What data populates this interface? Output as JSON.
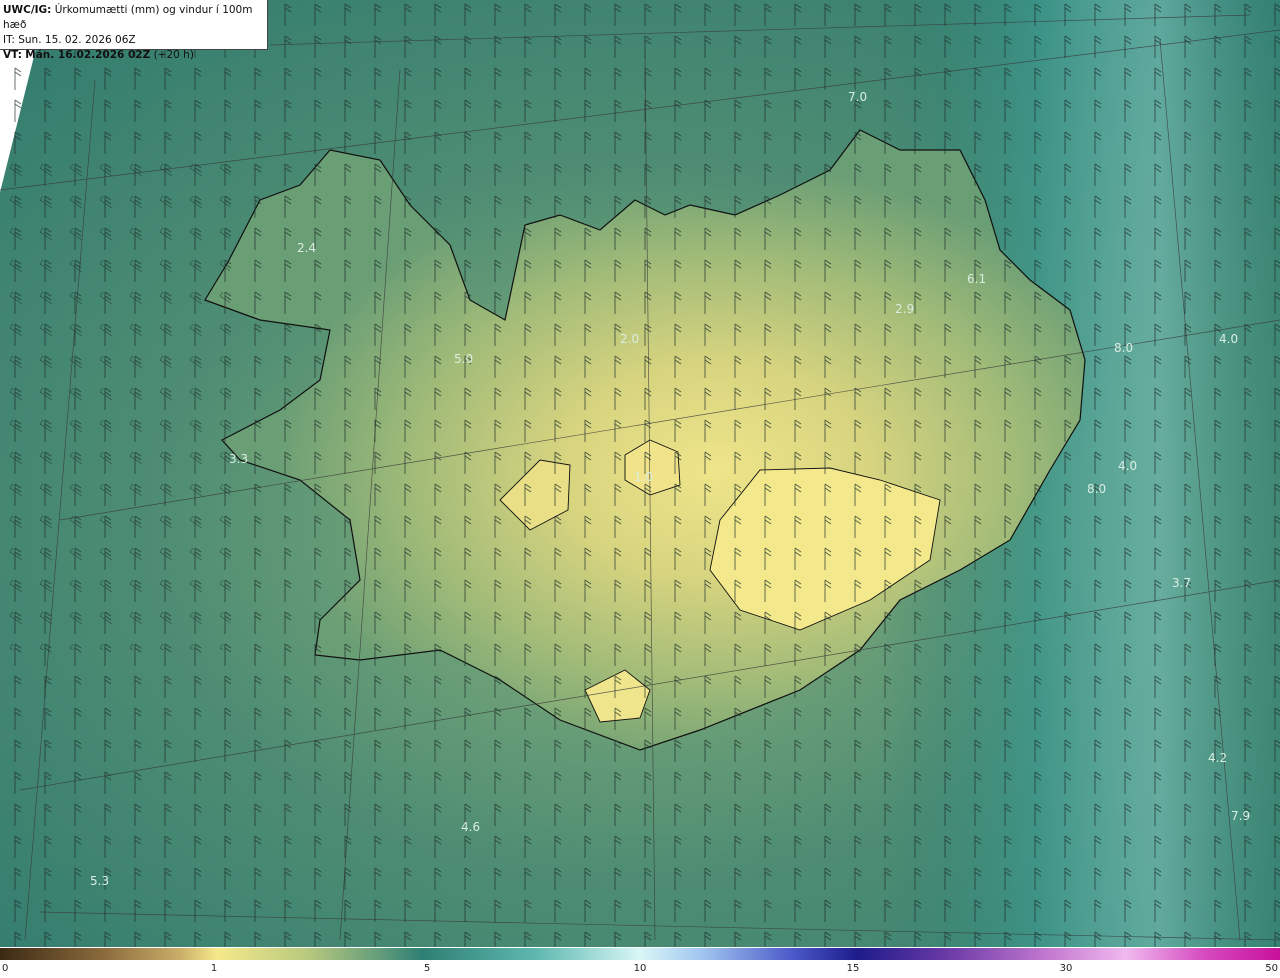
{
  "header": {
    "model": "UWC/IG:",
    "title": "Úrkomumætti (mm) og vindur í 100m hæð",
    "issued": "IT: Sun. 15. 02. 2026 06Z",
    "valid_prefix": "VT:",
    "valid": "Mán. 16.02.2026 02Z",
    "lead": "(+20 h)"
  },
  "map_values": [
    {
      "id": "v1",
      "label": "7.0"
    },
    {
      "id": "v2",
      "label": "2.4"
    },
    {
      "id": "v3",
      "label": "5.0"
    },
    {
      "id": "v4",
      "label": "2.0"
    },
    {
      "id": "v5",
      "label": "2.9"
    },
    {
      "id": "v6",
      "label": "6.1"
    },
    {
      "id": "v7",
      "label": "8.0"
    },
    {
      "id": "v8",
      "label": "4.0"
    },
    {
      "id": "v9",
      "label": "3.3"
    },
    {
      "id": "v10",
      "label": "1.0"
    },
    {
      "id": "v11",
      "label": "4.0"
    },
    {
      "id": "v12",
      "label": "8.0"
    },
    {
      "id": "v13",
      "label": "3.7"
    },
    {
      "id": "v14",
      "label": "4.6"
    },
    {
      "id": "v15",
      "label": "4.2"
    },
    {
      "id": "v16",
      "label": "7.9"
    },
    {
      "id": "v17",
      "label": "5.3"
    }
  ],
  "colorbar": {
    "ticks": [
      "0",
      "1",
      "5",
      "10",
      "15",
      "30",
      "50"
    ],
    "colors": {
      "dry": "#3b2a14",
      "low": "#f5e98a",
      "mid": "#2e7f73",
      "high": "#d8f6f6",
      "very_high": "#1d1c8a",
      "extreme": "#c8119c"
    }
  }
}
